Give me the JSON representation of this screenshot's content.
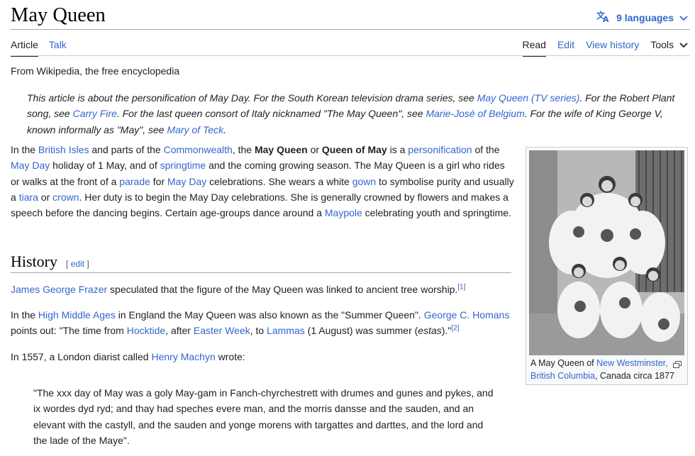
{
  "page": {
    "title": "May Queen",
    "languages_label": "9 languages",
    "tagline": "From Wikipedia, the free encyclopedia"
  },
  "tabs": {
    "article": "Article",
    "talk": "Talk",
    "read": "Read",
    "edit": "Edit",
    "view_history": "View history",
    "tools": "Tools"
  },
  "hatnote": {
    "t1": "This article is about the personification of May Day. For the South Korean television drama series, see ",
    "l1": "May Queen (TV series)",
    "t2": ". For the Robert Plant song, see ",
    "l2": "Carry Fire",
    "t3": ". For the last queen consort of Italy nicknamed \"The May Queen\", see ",
    "l3": "Marie-José of Belgium",
    "t4": ". For the wife of King George V, known informally as \"May\", see ",
    "l4": "Mary of Teck",
    "t5": "."
  },
  "lead": {
    "t1": "In the ",
    "l1": "British Isles",
    "t2": " and parts of the ",
    "l2": "Commonwealth",
    "t3": ", the ",
    "b1": "May Queen",
    "t4": " or ",
    "b2": "Queen of May",
    "t5": " is a ",
    "l3": "personification",
    "t6": " of the ",
    "l4": "May Day",
    "t7": " holiday of 1 May, and of ",
    "l5": "springtime",
    "t8": " and the coming growing season. The May Queen is a girl who rides or walks at the front of a ",
    "l6": "parade",
    "t9": " for ",
    "l7": "May Day",
    "t10": " celebrations. She wears a white ",
    "l8": "gown",
    "t11": " to symbolise purity and usually a ",
    "l9": "tiara",
    "t12": " or ",
    "l10": "crown",
    "t13": ". Her duty is to begin the May Day celebrations. She is generally crowned by flowers and makes a speech before the dancing begins. Certain age-groups dance around a ",
    "l11": "Maypole",
    "t14": " celebrating youth and springtime."
  },
  "history": {
    "heading": "History",
    "edit_open": "[ ",
    "edit_label": "edit",
    "edit_close": " ]",
    "p1": {
      "l1": "James George Frazer",
      "t1": " speculated that the figure of the May Queen was linked to ancient tree worship.",
      "ref": "[1]"
    },
    "p2": {
      "t1": "In the ",
      "l1": "High Middle Ages",
      "t2": " in England the May Queen was also known as the \"Summer Queen\". ",
      "l2": "George C. Homans",
      "t3": " points out: \"The time from ",
      "l3": "Hocktide",
      "t4": ", after ",
      "l4": "Easter Week",
      "t5": ", to ",
      "l5": "Lammas",
      "t6": " (1 August) was summer (",
      "i1": "estas",
      "t7": ").\"",
      "ref": "[2]"
    },
    "p3": {
      "t1": "In 1557, a London diarist called ",
      "l1": "Henry Machyn",
      "t2": " wrote:"
    },
    "quote": "\"The xxx day of May was a goly May-gam in Fanch-chyrchestrett with drumes and gunes and pykes, and ix wordes dyd ryd; and thay had speches evere man, and the morris dansse and the sauden, and an elevant with the castyll, and the sauden and yonge morens with targattes and darttes, and the lord and the lade of the Maye\"."
  },
  "figure": {
    "c1": "A May Queen of ",
    "l1": "New Westminster, British Columbia",
    "c2": ", Canada circa 1877"
  }
}
